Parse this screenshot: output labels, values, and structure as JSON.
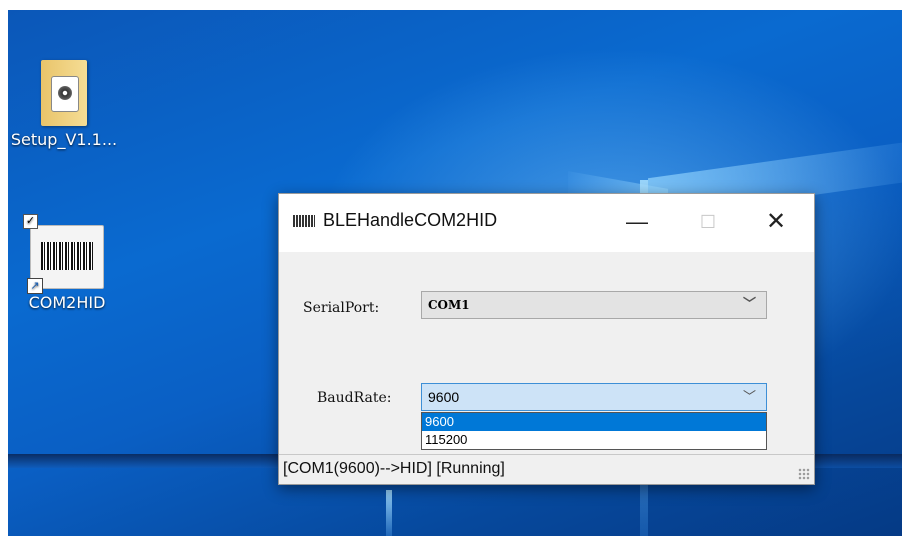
{
  "desktop": {
    "icons": [
      {
        "label": "Setup_V1.1...",
        "icon": "installer-folder-icon"
      },
      {
        "label": "COM2HID",
        "icon": "barcode-shortcut-icon"
      }
    ]
  },
  "window": {
    "title": "BLEHandleCOM2HID",
    "app_icon": "barcode-app-icon",
    "controls": {
      "minimize": "—",
      "maximize": "☐",
      "close": "✕"
    },
    "serial_port": {
      "label": "SerialPort:",
      "value": "COM1"
    },
    "baud_rate": {
      "label": "BaudRate:",
      "value": "9600",
      "options": [
        "9600",
        "115200"
      ],
      "selected_option": "9600"
    },
    "status": "[COM1(9600)-->HID]  [Running]"
  },
  "colors": {
    "selection": "#0078d7",
    "combo_focus": "#cde3f7",
    "desktop": "#0a5fc4"
  }
}
